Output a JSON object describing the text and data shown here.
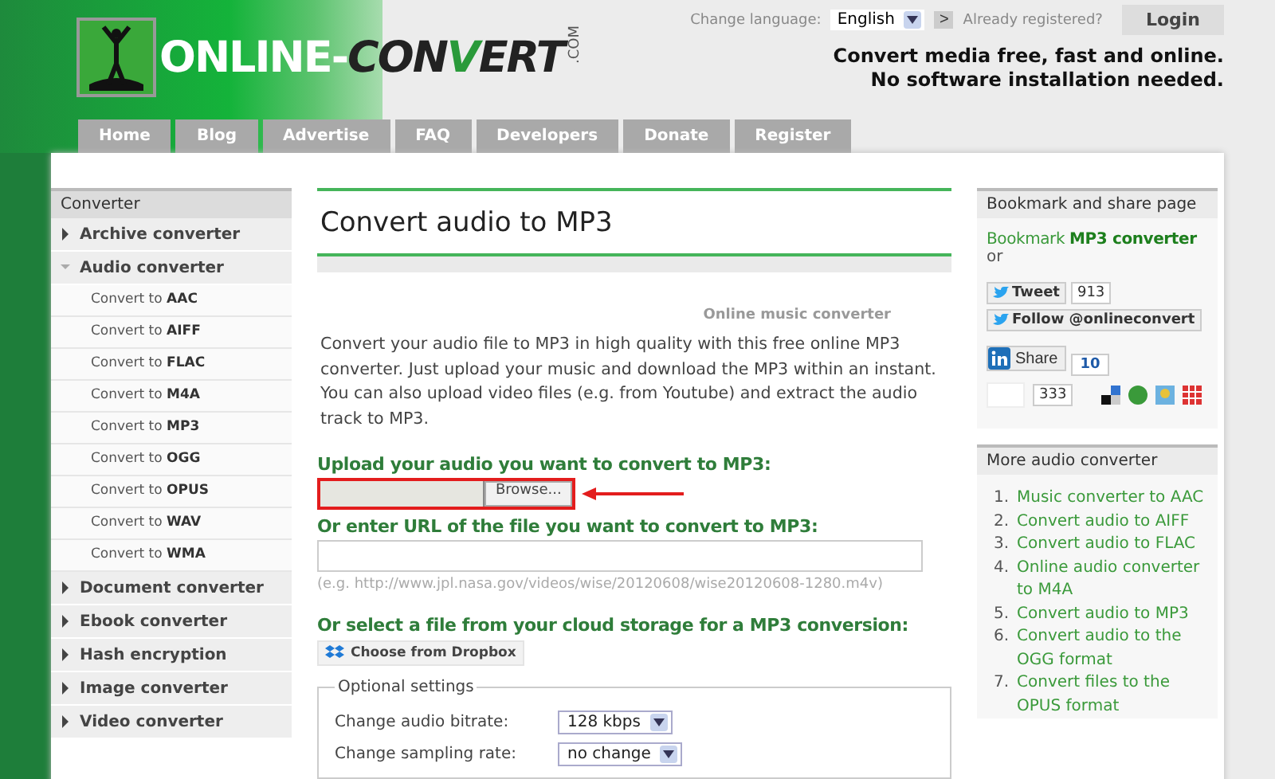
{
  "header": {
    "logo": {
      "part1": "ONLINE-",
      "part2a": "CON",
      "part2b": "V",
      "part2c": "ERT",
      "suffix": ".COM"
    },
    "language": {
      "label": "Change language:",
      "value": "English",
      "go": ">"
    },
    "registered": "Already registered?",
    "login": "Login",
    "slogan": [
      "Convert media free, fast and online.",
      "No software installation needed."
    ]
  },
  "nav": [
    {
      "label": "Home",
      "selected": false
    },
    {
      "label": "Blog",
      "selected": false
    },
    {
      "label": "Advertise",
      "selected": false
    },
    {
      "label": "FAQ",
      "selected": false
    },
    {
      "label": "Developers",
      "selected": false
    },
    {
      "label": "Donate",
      "selected": false
    },
    {
      "label": "Register",
      "selected": false
    }
  ],
  "sidebar": {
    "title": "Converter",
    "items": [
      {
        "label": "Archive converter",
        "expanded": false
      },
      {
        "label": "Audio converter",
        "expanded": true,
        "children": [
          {
            "label": "Convert to **AAC**"
          },
          {
            "label": "Convert to **AIFF**"
          },
          {
            "label": "Convert to **FLAC**"
          },
          {
            "label": "Convert to **M4A**"
          },
          {
            "label": "Convert to **MP3**"
          },
          {
            "label": "Convert to **OGG**"
          },
          {
            "label": "Convert to **OPUS**"
          },
          {
            "label": "Convert to **WAV**"
          },
          {
            "label": "Convert to **WMA**"
          }
        ]
      },
      {
        "label": "Document converter",
        "expanded": false
      },
      {
        "label": "Ebook converter",
        "expanded": false
      },
      {
        "label": "Hash encryption",
        "expanded": false
      },
      {
        "label": "Image converter",
        "expanded": false
      },
      {
        "label": "Video converter",
        "expanded": false
      }
    ]
  },
  "main": {
    "title": "Convert audio to MP3",
    "subtitle": "Online music converter",
    "description": "Convert your audio file to MP3 in high quality with this free online MP3 converter. Just upload your music and download the MP3 within an instant. You can also upload video files (e.g. from Youtube) and extract the audio track to MP3.",
    "upload_label": "Upload your audio you want to convert to MP3:",
    "browse": "Browse...",
    "url_label": "Or enter URL of the file you want to convert to MP3:",
    "url_hint": "(e.g. http://www.jpl.nasa.gov/videos/wise/20120608/wise20120608-1280.m4v)",
    "cloud_label": "Or select a file from your cloud storage for a MP3 conversion:",
    "dropbox": "Choose from Dropbox",
    "optional": {
      "legend": "Optional settings",
      "rows": [
        {
          "label": "Change audio bitrate:",
          "value": "128 kbps"
        },
        {
          "label": "Change sampling rate:",
          "value": "no change"
        }
      ]
    }
  },
  "right": {
    "bookmark": {
      "title": "Bookmark and share page",
      "text": "Bookmark **MP3 converter**",
      "or": "or",
      "tweet": "Tweet",
      "tweet_count": "913",
      "follow": "Follow @onlineconvert",
      "share": "Share",
      "share_count": "10",
      "plus_count": "333"
    },
    "more": {
      "title": "More audio converter",
      "items": [
        {
          "number": "1.",
          "label": "Music converter to AAC"
        },
        {
          "number": "2.",
          "label": "Convert audio to AIFF"
        },
        {
          "number": "3.",
          "label": "Convert audio to FLAC"
        },
        {
          "number": "4.",
          "label": "Online audio converter to M4A"
        },
        {
          "number": "5.",
          "label": "Convert audio to MP3"
        },
        {
          "number": "6.",
          "label": "Convert audio to the OGG format"
        },
        {
          "number": "7.",
          "label": "Convert files to the OPUS format"
        }
      ]
    }
  }
}
